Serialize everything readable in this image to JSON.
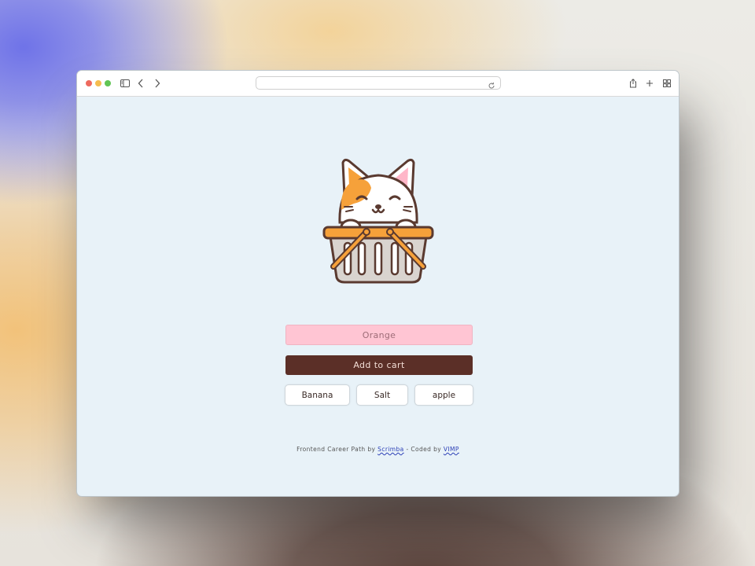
{
  "browser": {
    "url": "",
    "icons": [
      "sidebar-icon",
      "back-icon",
      "forward-icon",
      "reload-icon",
      "share-icon",
      "new-tab-icon",
      "tab-overview-icon"
    ]
  },
  "app": {
    "input": {
      "placeholder": "Orange",
      "value": ""
    },
    "add_button_label": "Add to cart",
    "cart_items": [
      "Banana",
      "Salt",
      "apple"
    ]
  },
  "footer": {
    "prefix": "Frontend Career Path by",
    "link1": "Scrimba",
    "middle": "- Coded by",
    "link2": "VIMP"
  },
  "colors": {
    "page_bg": "#e8f2f8",
    "input_bg": "#ffc5d3",
    "button_bg": "#5b2f27",
    "link": "#2b3fb6"
  }
}
